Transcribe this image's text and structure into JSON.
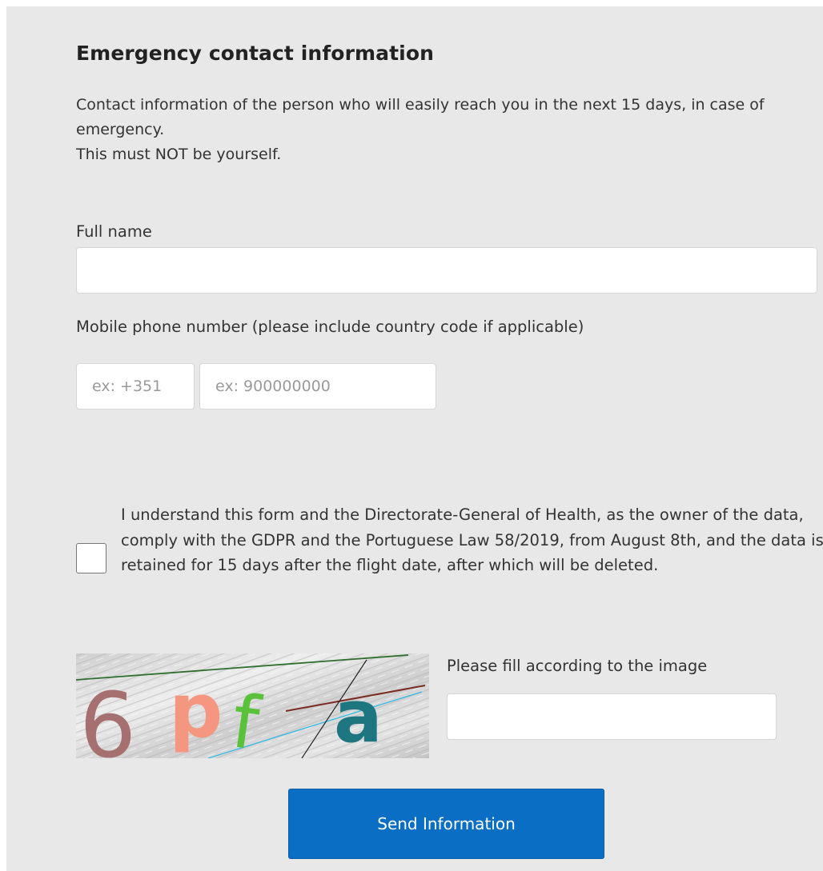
{
  "form": {
    "title": "Emergency contact information",
    "intro": [
      "Contact information of the person who will easily reach you in the next 15 days, in case of emergency.",
      "This must NOT be yourself."
    ],
    "full_name": {
      "label": "Full name",
      "value": "",
      "placeholder": ""
    },
    "phone": {
      "label": "Mobile phone number (please include country code if applicable)",
      "country_code_placeholder": "ex: +351",
      "number_placeholder": "ex: 900000000",
      "country_code_value": "",
      "number_value": ""
    },
    "consent": {
      "checked": false,
      "text": "I understand this form and the Directorate-General of Health, as the owner of the data, comply with the GDPR and the Portuguese Law 58/2019, from August 8th, and the data is retained for 15 days after the flight date, after which will be deleted."
    },
    "captcha": {
      "characters": [
        "6",
        "p",
        "f",
        "a"
      ],
      "colors": [
        "#a67070",
        "#f59680",
        "#5ac23a",
        "#1d7680"
      ],
      "instruction": "Please fill according to the image",
      "value": ""
    },
    "submit_label": "Send Information"
  }
}
